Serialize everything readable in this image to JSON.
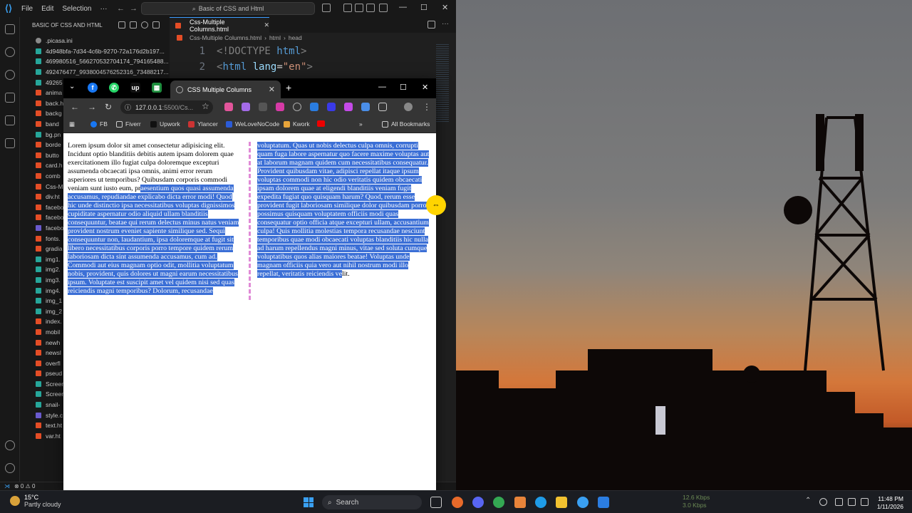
{
  "vscode": {
    "menu": [
      "File",
      "Edit",
      "Selection"
    ],
    "search_text": "Basic of CSS and Html",
    "explorer_title": "BASIC OF CSS AND HTML",
    "files": [
      {
        "name": ".picasa.ini",
        "type": "gear"
      },
      {
        "name": "4d948bfa-7d34-4c6b-9270-72a176d2b197...",
        "type": "img"
      },
      {
        "name": "469980516_566270532704174_794165488...",
        "type": "img"
      },
      {
        "name": "492476477_9938004576252316_73488217...",
        "type": "img"
      },
      {
        "name": "49265",
        "type": "img"
      },
      {
        "name": "anima",
        "type": "html"
      },
      {
        "name": "back.h",
        "type": "html"
      },
      {
        "name": "backg",
        "type": "html"
      },
      {
        "name": "band",
        "type": "html"
      },
      {
        "name": "bg.pn",
        "type": "img"
      },
      {
        "name": "borde",
        "type": "html"
      },
      {
        "name": "butto",
        "type": "html"
      },
      {
        "name": "card.h",
        "type": "html"
      },
      {
        "name": "comb",
        "type": "html"
      },
      {
        "name": "Css-M",
        "type": "html"
      },
      {
        "name": "div.ht",
        "type": "html"
      },
      {
        "name": "facebo",
        "type": "html"
      },
      {
        "name": "facebo",
        "type": "html"
      },
      {
        "name": "facebo",
        "type": "css"
      },
      {
        "name": "fonts.",
        "type": "html"
      },
      {
        "name": "gradia",
        "type": "html"
      },
      {
        "name": "img1.",
        "type": "img"
      },
      {
        "name": "img2.",
        "type": "img"
      },
      {
        "name": "img3.",
        "type": "img"
      },
      {
        "name": "img4.",
        "type": "img"
      },
      {
        "name": "img_1",
        "type": "img"
      },
      {
        "name": "img_2",
        "type": "img"
      },
      {
        "name": "index.",
        "type": "html"
      },
      {
        "name": "mobil",
        "type": "html"
      },
      {
        "name": "newh",
        "type": "html"
      },
      {
        "name": "newsl",
        "type": "html"
      },
      {
        "name": "overfl",
        "type": "html"
      },
      {
        "name": "pseud",
        "type": "html"
      },
      {
        "name": "Screen",
        "type": "img"
      },
      {
        "name": "Screen",
        "type": "img"
      },
      {
        "name": "snail-",
        "type": "img"
      },
      {
        "name": "style.c",
        "type": "css"
      },
      {
        "name": "text.ht",
        "type": "html"
      },
      {
        "name": "var.ht",
        "type": "html"
      }
    ],
    "tab_label": "Css-Multiple Columns.html",
    "breadcrumb": {
      "file": "Css-Multiple Columns.html",
      "b1": "html",
      "b2": "head"
    },
    "code": [
      {
        "num": "1",
        "doctype_open": "<!DOCTYPE ",
        "doctype_kw": "html",
        "doctype_close": ">"
      },
      {
        "num": "2",
        "open": "<",
        "tag": "html",
        "attr": " lang",
        "eq": "=",
        "val": "\"en\"",
        "close": ">"
      }
    ],
    "status": "⊗ 0 ⚠ 0"
  },
  "browser": {
    "tab_title": "CSS Multiple Columns",
    "url_host": "127.0.0.1",
    "url_rest": ":5500/Cs...",
    "bookmarks": [
      "FB",
      "Fiverr",
      "Upwork",
      "Ylancer",
      "WeLoveNoCode",
      "Kwork"
    ],
    "all_bookmarks": "All Bookmarks",
    "content": {
      "plain_before": "Lorem ipsum dolor sit amet consectetur adipisicing elit. Incidunt optio blanditiis debitis autem ipsam dolorem quae exercitationem illo fugiat culpa doloremque excepturi assumenda obcaecati ipsa omnis, animi error rerum asperiores ut temporibus? Quibusdam corporis commodi veniam sunt iusto eum, pr",
      "selected": "aesentium quos quasi assumenda accusamus, repudiandae explicabo dicta error modi! Quod hic unde distinctio ipsa necessitatibus voluptas dignissimos cupiditate aspernatur odio aliquid ullam blanditiis consequuntur, beatae qui rerum delectus minus natus veniam provident nostrum eveniet sapiente similique sed. Sequi consequuntur non, laudantium, ipsa doloremque at fugit sit libero necessitatibus corporis porro tempore quidem rerum laboriosam dicta sint assumenda accusamus, cum ad. Commodi aut eius magnam optio odit, mollitia voluptatum nobis, provident, quis dolores ut magni earum necessitatibus ipsum. Voluptate est suscipit amet vel quidem nisi sed quas reiciendis magni temporibus? Dolorum, recusandae voluptatum. Quas ut nobis delectus culpa omnis, corrupti quam fuga labore aspernatur quo facere maxime voluptas aut at laborum magnam quidem cum necessitatibus consequatur. Provident quibusdam vitae, adipisci repellat itaque ipsum voluptas commodi non hic odio veritatis quidem obcaecati ipsam dolorem quae at eligendi blanditiis veniam fugit expedita fugiat quo quisquam harum? Quod, rerum esse provident fugit laboriosam similique dolor quibusdam porro possimus quisquam voluptatem officiis modi quas consequatur optio officia atque excepturi ullam, accusantium culpa! Quis mollitia molestias tempora recusandae nesciunt temporibus quae modi obcaecati voluptas blanditiis hic nulla ad harum repellendus magni minus, vitae sed soluta cumque voluptatibus quos alias maiores beatae! Voluptas unde magnam officiis quia vero aut nihil nostrum modi illo repellat, veritatis reiciendis ve",
      "plain_after": "lit."
    }
  },
  "taskbar": {
    "temperature": "15°C",
    "weather": "Partly cloudy",
    "search": "Search",
    "net_up": "12.6 Kbps",
    "net_down": "3.0 Kbps",
    "time": "11:48 PM",
    "date": "1/11/2026"
  }
}
